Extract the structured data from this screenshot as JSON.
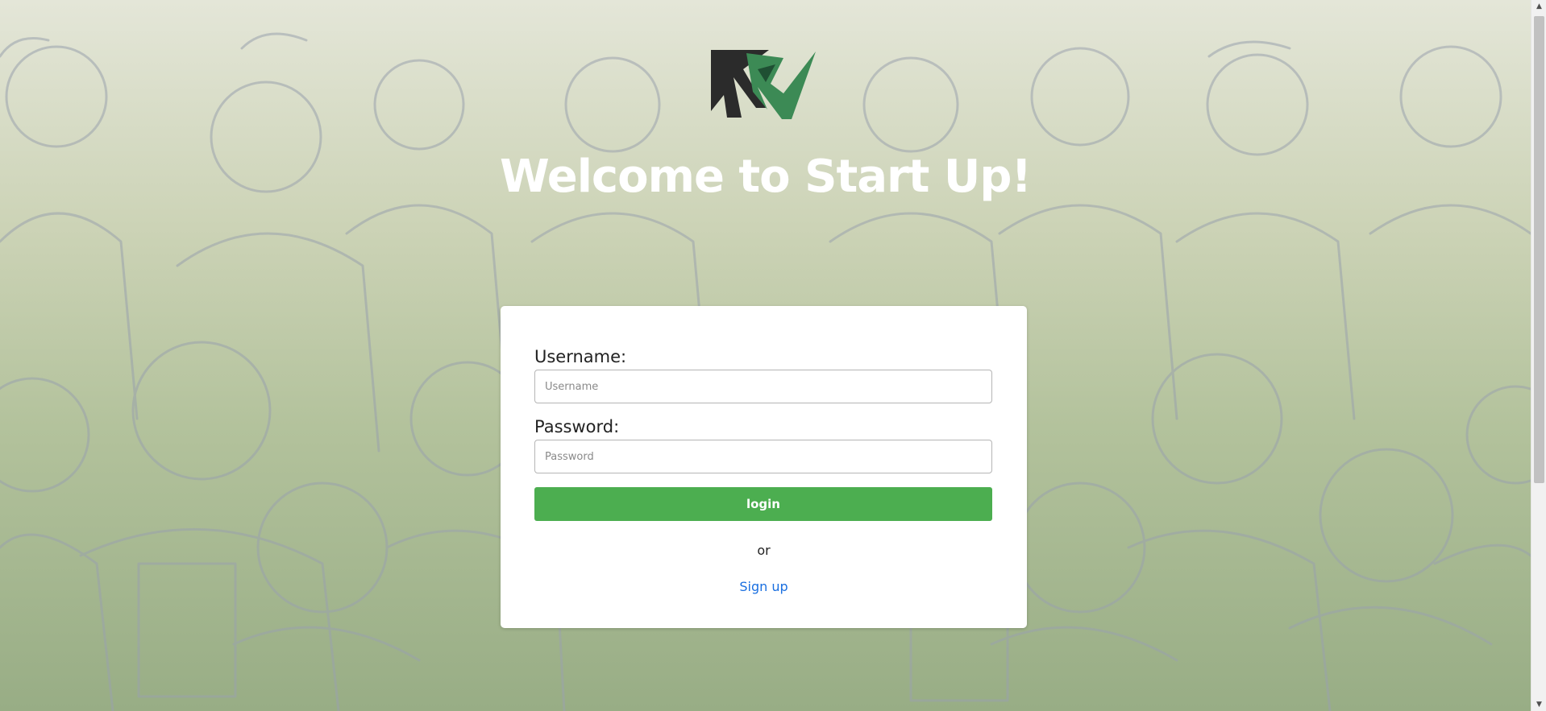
{
  "header": {
    "logo_icon": "startup-checkmark-logo",
    "title": "Welcome to Start Up!"
  },
  "login_form": {
    "username_label": "Username:",
    "username_placeholder": "Username",
    "username_value": "",
    "password_label": "Password:",
    "password_placeholder": "Password",
    "password_value": "",
    "login_button": "login",
    "or_text": "or",
    "signup_link": "Sign up"
  },
  "colors": {
    "brand_green": "#4cae50",
    "logo_dark": "#2b2b2b",
    "logo_green": "#3c8a55",
    "link_blue": "#1a6fe0"
  },
  "scrollbar": {
    "up_icon": "scroll-up-arrow-icon",
    "down_icon": "scroll-down-arrow-icon"
  }
}
